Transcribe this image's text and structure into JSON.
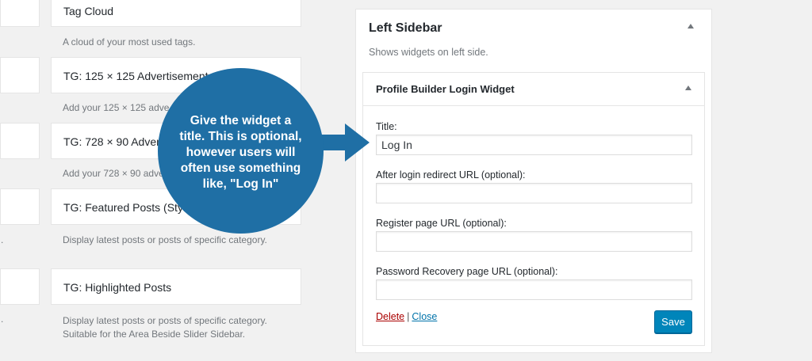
{
  "available_widgets": [
    {
      "title": "Tag Cloud",
      "description": "A cloud of your most used tags."
    },
    {
      "title": "TG: 125 × 125 Advertisement",
      "description": "Add your 125 × 125 adve"
    },
    {
      "title": "TG: 728 × 90 Adverti",
      "description": "Add your 728 × 90 adve"
    },
    {
      "title": "TG: Featured Posts (Style 1",
      "description": "Display latest posts or posts of specific category."
    },
    {
      "title": "TG: Highlighted Posts",
      "description_line1": "Display latest posts or posts of specific category.",
      "description_line2": "Suitable for the Area Beside Slider Sidebar."
    }
  ],
  "left_edge_marks": [
    ".",
    "."
  ],
  "sidebar": {
    "title": "Left Sidebar",
    "description": "Shows widgets on left side.",
    "widget": {
      "title": "Profile Builder Login Widget",
      "fields": [
        {
          "label": "Title:",
          "value": "Log In"
        },
        {
          "label": "After login redirect URL (optional):",
          "value": ""
        },
        {
          "label": "Register page URL (optional):",
          "value": ""
        },
        {
          "label": "Password Recovery page URL (optional):",
          "value": ""
        }
      ],
      "delete_label": "Delete",
      "separator": "|",
      "close_label": "Close",
      "save_label": "Save"
    }
  },
  "callout": {
    "line1": "Give the widget a",
    "line2": "title. This is optional,",
    "line3": "however users will",
    "line4": "often use something",
    "line5": "like, \"Log In\""
  },
  "colors": {
    "callout": "#1f6fa5",
    "save_button": "#0085ba",
    "delete_link": "#aa0000",
    "close_link": "#0073aa",
    "background": "#f1f1f1"
  },
  "icons": [
    "collapse-arrow-icon",
    "callout-arrow-icon"
  ]
}
